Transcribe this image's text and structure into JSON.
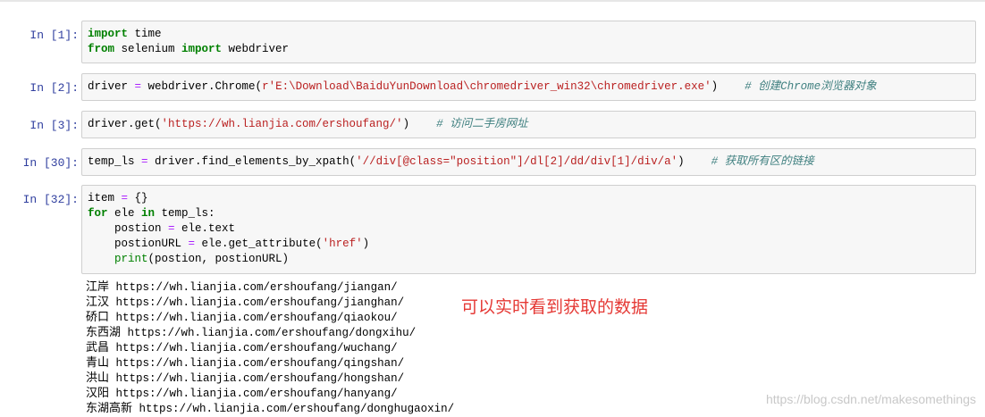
{
  "cells": [
    {
      "prompt": "In [1]:",
      "lines": [
        [
          {
            "t": "import",
            "c": "kw"
          },
          {
            "t": " time",
            "c": ""
          }
        ],
        [
          {
            "t": "from",
            "c": "kw"
          },
          {
            "t": " selenium ",
            "c": ""
          },
          {
            "t": "import",
            "c": "kw"
          },
          {
            "t": " webdriver",
            "c": ""
          }
        ]
      ]
    },
    {
      "prompt": "In [2]:",
      "lines": [
        [
          {
            "t": "driver ",
            "c": ""
          },
          {
            "t": "=",
            "c": "op"
          },
          {
            "t": " webdriver.Chrome(",
            "c": ""
          },
          {
            "t": "r'E:\\Download\\BaiduYunDownload\\chromedriver_win32\\chromedriver.exe'",
            "c": "str"
          },
          {
            "t": ")    ",
            "c": ""
          },
          {
            "t": "# 创建Chrome浏览器对象",
            "c": "cm"
          }
        ]
      ]
    },
    {
      "prompt": "In [3]:",
      "lines": [
        [
          {
            "t": "driver.get(",
            "c": ""
          },
          {
            "t": "'https://wh.lianjia.com/ershoufang/'",
            "c": "str"
          },
          {
            "t": ")    ",
            "c": ""
          },
          {
            "t": "# 访问二手房网址",
            "c": "cm"
          }
        ]
      ]
    },
    {
      "prompt": "In [30]:",
      "lines": [
        [
          {
            "t": "temp_ls ",
            "c": ""
          },
          {
            "t": "=",
            "c": "op"
          },
          {
            "t": " driver.find_elements_by_xpath(",
            "c": ""
          },
          {
            "t": "'//div[@class=\"position\"]/dl[2]/dd/div[1]/div/a'",
            "c": "str"
          },
          {
            "t": ")    ",
            "c": ""
          },
          {
            "t": "# 获取所有区的链接",
            "c": "cm"
          }
        ]
      ]
    },
    {
      "prompt": "In [32]:",
      "lines": [
        [
          {
            "t": "item ",
            "c": ""
          },
          {
            "t": "=",
            "c": "op"
          },
          {
            "t": " {}",
            "c": ""
          }
        ],
        [
          {
            "t": "for",
            "c": "kw"
          },
          {
            "t": " ele ",
            "c": ""
          },
          {
            "t": "in",
            "c": "kw"
          },
          {
            "t": " temp_ls:",
            "c": ""
          }
        ],
        [
          {
            "t": "    postion ",
            "c": ""
          },
          {
            "t": "=",
            "c": "op"
          },
          {
            "t": " ele.text",
            "c": ""
          }
        ],
        [
          {
            "t": "    postionURL ",
            "c": ""
          },
          {
            "t": "=",
            "c": "op"
          },
          {
            "t": " ele.get_attribute(",
            "c": ""
          },
          {
            "t": "'href'",
            "c": "str"
          },
          {
            "t": ")",
            "c": ""
          }
        ],
        [
          {
            "t": "    ",
            "c": ""
          },
          {
            "t": "print",
            "c": "bi"
          },
          {
            "t": "(postion, postionURL)",
            "c": ""
          }
        ]
      ]
    }
  ],
  "output": [
    {
      "name": "江岸",
      "url": "https://wh.lianjia.com/ershoufang/jiangan/"
    },
    {
      "name": "江汉",
      "url": "https://wh.lianjia.com/ershoufang/jianghan/"
    },
    {
      "name": "硚口",
      "url": "https://wh.lianjia.com/ershoufang/qiaokou/"
    },
    {
      "name": "东西湖",
      "url": "https://wh.lianjia.com/ershoufang/dongxihu/"
    },
    {
      "name": "武昌",
      "url": "https://wh.lianjia.com/ershoufang/wuchang/"
    },
    {
      "name": "青山",
      "url": "https://wh.lianjia.com/ershoufang/qingshan/"
    },
    {
      "name": "洪山",
      "url": "https://wh.lianjia.com/ershoufang/hongshan/"
    },
    {
      "name": "汉阳",
      "url": "https://wh.lianjia.com/ershoufang/hanyang/"
    },
    {
      "name": "东湖高新",
      "url": "https://wh.lianjia.com/ershoufang/donghugaoxin/"
    }
  ],
  "annotation": "可以实时看到获取的数据",
  "watermark": "https://blog.csdn.net/makesomethings",
  "colors": {
    "prompt": "#303f9f",
    "keyword": "#008000",
    "string": "#ba2121",
    "comment": "#408080",
    "annotation": "#e53935"
  }
}
